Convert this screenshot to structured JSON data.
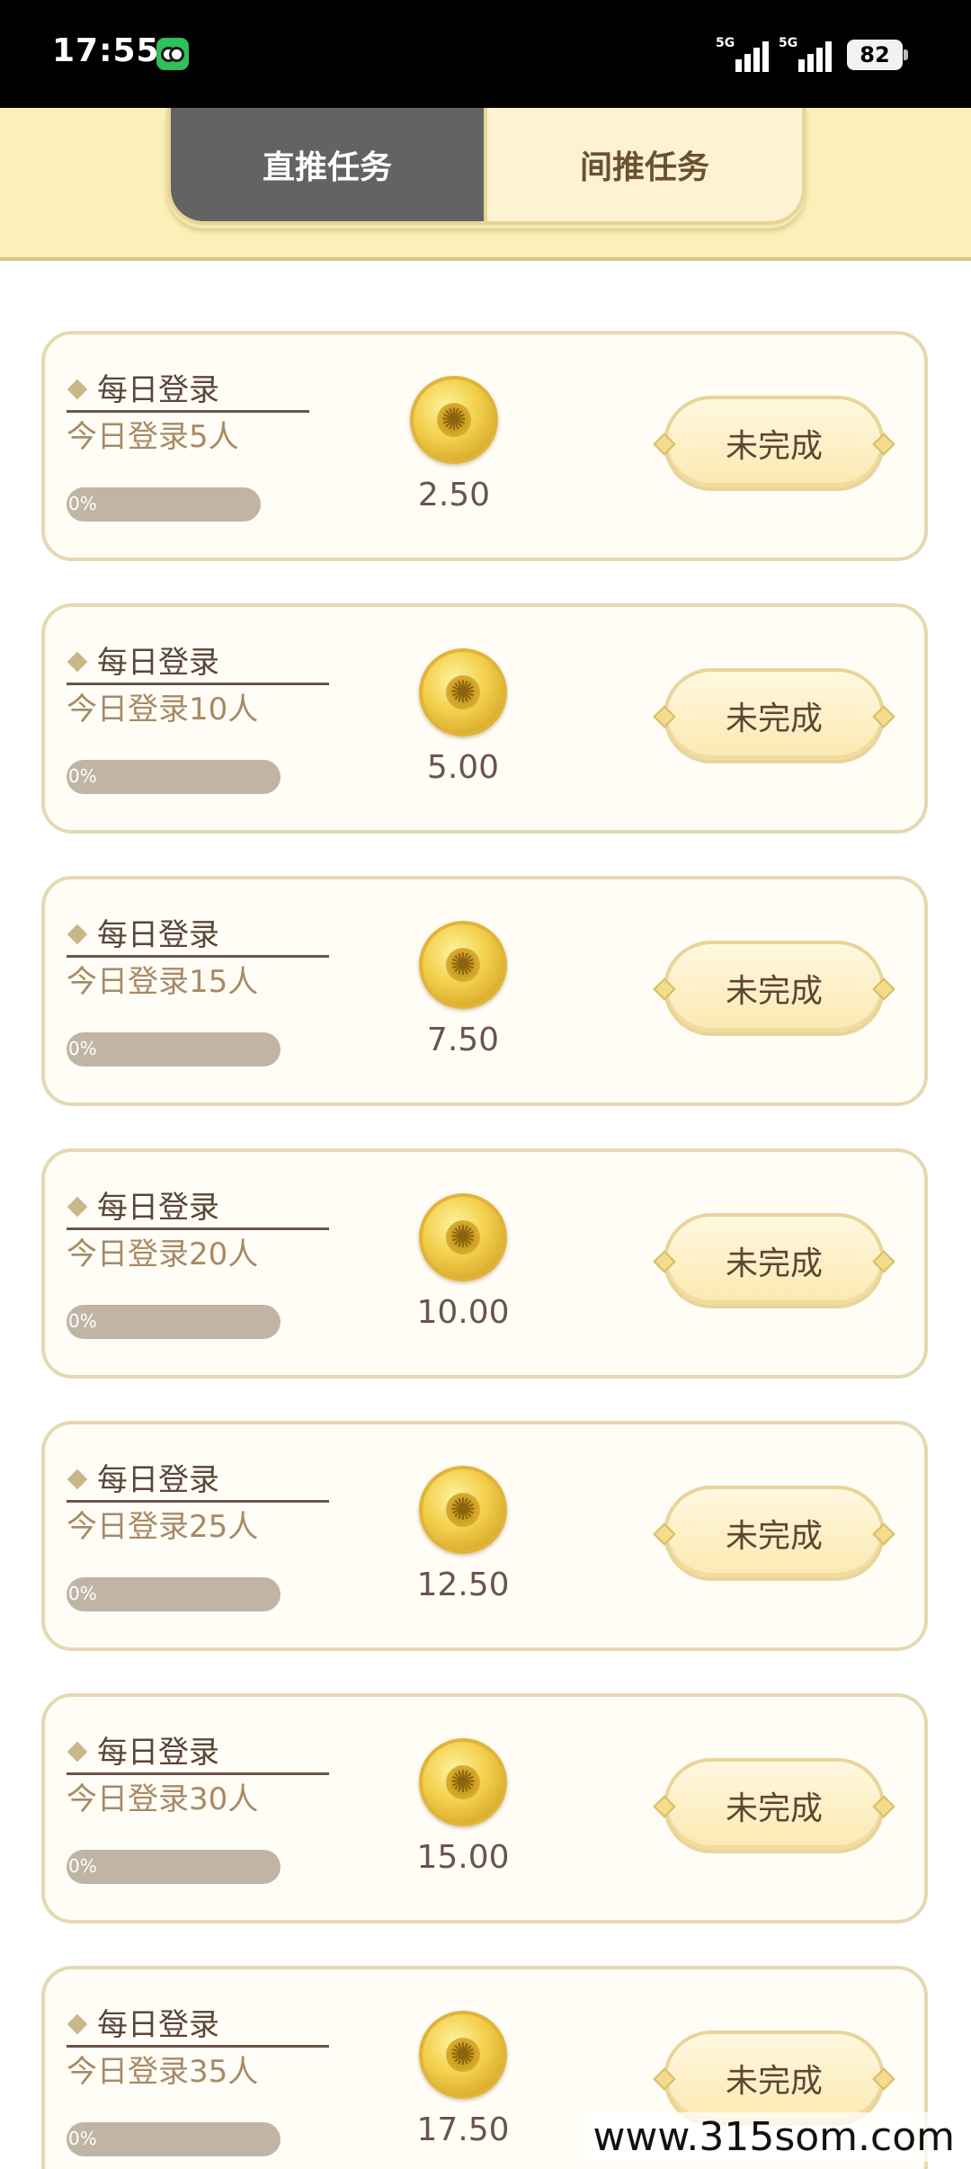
{
  "status_bar": {
    "time": "17:55",
    "net1": "5G",
    "net2": "5G",
    "battery": "82",
    "app_icon": "owl-app-icon"
  },
  "tabs": [
    {
      "label": "直推任务",
      "active": true
    },
    {
      "label": "间推任务",
      "active": false
    }
  ],
  "tasks": [
    {
      "title": "每日登录",
      "desc": "今日登录5人",
      "progress": "0%",
      "reward": "2.50",
      "status": "未完成"
    },
    {
      "title": "每日登录",
      "desc": "今日登录10人",
      "progress": "0%",
      "reward": "5.00",
      "status": "未完成"
    },
    {
      "title": "每日登录",
      "desc": "今日登录15人",
      "progress": "0%",
      "reward": "7.50",
      "status": "未完成"
    },
    {
      "title": "每日登录",
      "desc": "今日登录20人",
      "progress": "0%",
      "reward": "10.00",
      "status": "未完成"
    },
    {
      "title": "每日登录",
      "desc": "今日登录25人",
      "progress": "0%",
      "reward": "12.50",
      "status": "未完成"
    },
    {
      "title": "每日登录",
      "desc": "今日登录30人",
      "progress": "0%",
      "reward": "15.00",
      "status": "未完成"
    },
    {
      "title": "每日登录",
      "desc": "今日登录35人",
      "progress": "0%",
      "reward": "17.50",
      "status": "未完成"
    }
  ],
  "watermark": "www.315som.com",
  "colors": {
    "header_bg": "#fbf0b8",
    "active_tab": "#636363",
    "card_border": "#e5d8b3",
    "coin": "#f2cf4a"
  }
}
